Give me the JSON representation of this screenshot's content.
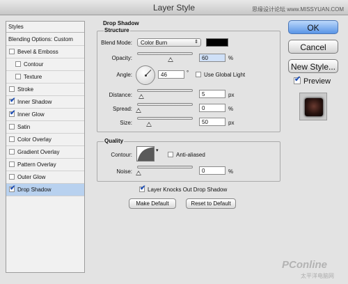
{
  "window": {
    "title": "Layer Style"
  },
  "watermark": {
    "top": "思缘设计论坛 www.MISSYUAN.COM",
    "logo": "PConline",
    "logo_sub": "太平洋电脑网"
  },
  "styles_panel": {
    "header": "Styles",
    "blending_options": "Blending Options: Custom",
    "items": [
      {
        "label": "Bevel & Emboss",
        "checked": false
      },
      {
        "label": "Contour",
        "checked": false
      },
      {
        "label": "Texture",
        "checked": false
      },
      {
        "label": "Stroke",
        "checked": false
      },
      {
        "label": "Inner Shadow",
        "checked": true
      },
      {
        "label": "Inner Glow",
        "checked": true
      },
      {
        "label": "Satin",
        "checked": false
      },
      {
        "label": "Color Overlay",
        "checked": false
      },
      {
        "label": "Gradient Overlay",
        "checked": false
      },
      {
        "label": "Pattern Overlay",
        "checked": false
      },
      {
        "label": "Outer Glow",
        "checked": false
      },
      {
        "label": "Drop Shadow",
        "checked": true
      }
    ]
  },
  "drop_shadow": {
    "section_title": "Drop Shadow",
    "structure": {
      "title": "Structure",
      "blend_mode_label": "Blend Mode:",
      "blend_mode_value": "Color Burn",
      "shadow_color": "#000000",
      "opacity_label": "Opacity:",
      "opacity_value": "60",
      "opacity_unit": "%",
      "opacity_level": 0.6,
      "angle_label": "Angle:",
      "angle_value": "46",
      "angle_unit": "°",
      "use_global_light_label": "Use Global Light",
      "use_global_light_checked": false,
      "distance_label": "Distance:",
      "distance_value": "5",
      "distance_unit": "px",
      "distance_level": 0.05,
      "spread_label": "Spread:",
      "spread_value": "0",
      "spread_unit": "%",
      "spread_level": 0.0,
      "size_label": "Size:",
      "size_value": "50",
      "size_unit": "px",
      "size_level": 0.2
    },
    "quality": {
      "title": "Quality",
      "contour_label": "Contour:",
      "anti_aliased_label": "Anti-aliased",
      "anti_aliased_checked": false,
      "noise_label": "Noise:",
      "noise_value": "0",
      "noise_unit": "%",
      "noise_level": 0.0
    },
    "knocks_out_label": "Layer Knocks Out Drop Shadow",
    "knocks_out_checked": true,
    "make_default_label": "Make Default",
    "reset_default_label": "Reset to Default"
  },
  "buttons": {
    "ok": "OK",
    "cancel": "Cancel",
    "new_style": "New Style...",
    "preview_label": "Preview",
    "preview_checked": true
  }
}
